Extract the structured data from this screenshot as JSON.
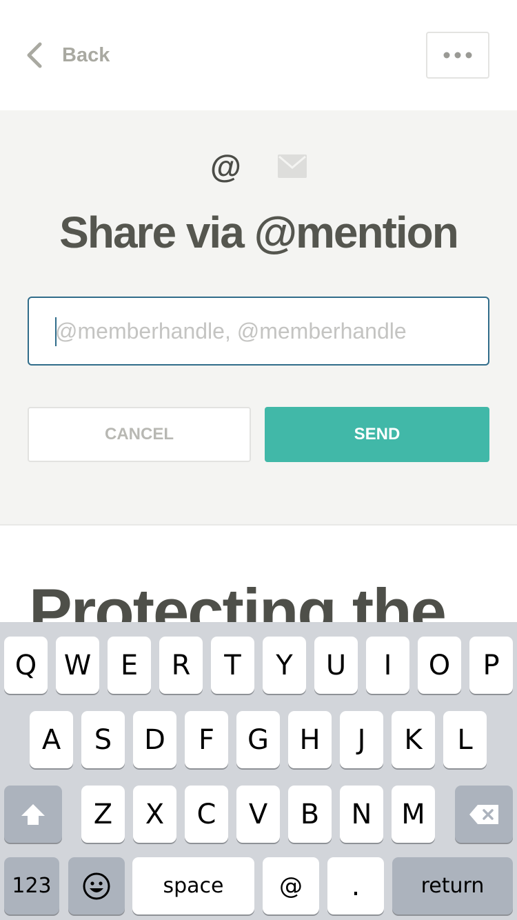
{
  "nav": {
    "back_label": "Back",
    "more_icon": "more-horizontal-icon"
  },
  "share": {
    "mode_at_symbol": "@",
    "mode_mail_icon": "mail-icon",
    "title": "Share via @mention",
    "input_placeholder": "@memberhandle, @memberhandle",
    "input_value": "",
    "cancel_label": "CANCEL",
    "send_label": "SEND"
  },
  "article": {
    "title_partial": "Protecting the"
  },
  "keyboard": {
    "row1": [
      "Q",
      "W",
      "E",
      "R",
      "T",
      "Y",
      "U",
      "I",
      "O",
      "P"
    ],
    "row2": [
      "A",
      "S",
      "D",
      "F",
      "G",
      "H",
      "J",
      "K",
      "L"
    ],
    "row3": [
      "Z",
      "X",
      "C",
      "V",
      "B",
      "N",
      "M"
    ],
    "shift_icon": "shift-icon",
    "delete_icon": "delete-icon",
    "numbers_label": "123",
    "emoji_icon": "emoji-icon",
    "space_label": "space",
    "at_label": "@",
    "period_label": ".",
    "return_label": "return"
  },
  "colors": {
    "accent": "#41b8a8",
    "input_border": "#2f6c8a",
    "heading": "#55564f",
    "panel_bg": "#f4f4f2"
  }
}
